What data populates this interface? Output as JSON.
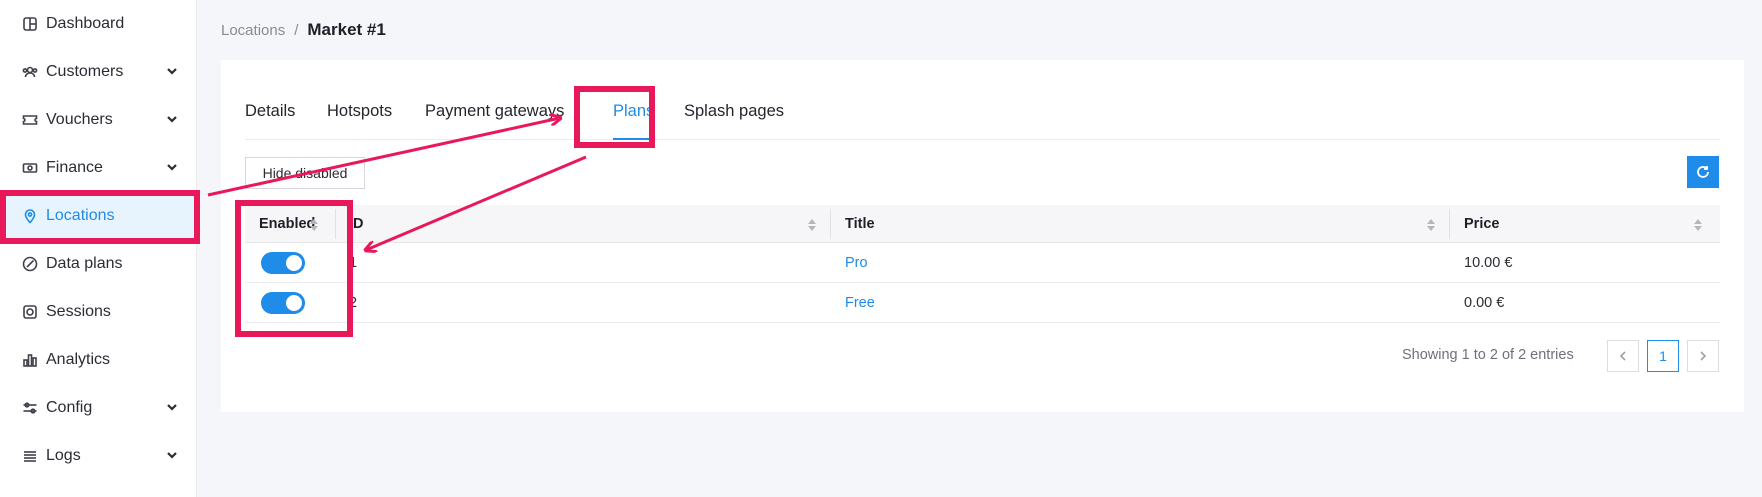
{
  "sidebar": {
    "items": [
      {
        "label": "Dashboard",
        "icon": "dashboard-icon",
        "has_chevron": false
      },
      {
        "label": "Customers",
        "icon": "customers-icon",
        "has_chevron": true
      },
      {
        "label": "Vouchers",
        "icon": "voucher-icon",
        "has_chevron": true
      },
      {
        "label": "Finance",
        "icon": "finance-icon",
        "has_chevron": true
      },
      {
        "label": "Locations",
        "icon": "location-pin-icon",
        "has_chevron": false,
        "active": true
      },
      {
        "label": "Data plans",
        "icon": "data-plans-icon",
        "has_chevron": false
      },
      {
        "label": "Sessions",
        "icon": "sessions-icon",
        "has_chevron": false
      },
      {
        "label": "Analytics",
        "icon": "analytics-icon",
        "has_chevron": false
      },
      {
        "label": "Config",
        "icon": "config-icon",
        "has_chevron": true
      },
      {
        "label": "Logs",
        "icon": "logs-icon",
        "has_chevron": true
      }
    ]
  },
  "breadcrumb": {
    "parent": "Locations",
    "separator": "/",
    "current": "Market #1"
  },
  "tabs": [
    {
      "label": "Details"
    },
    {
      "label": "Hotspots"
    },
    {
      "label": "Payment gateways"
    },
    {
      "label": "Plans",
      "active": true
    },
    {
      "label": "Splash pages"
    }
  ],
  "toolbar": {
    "hide_disabled_label": "Hide disabled",
    "refresh_icon": "refresh-icon"
  },
  "table": {
    "columns": [
      "Enabled",
      "ID",
      "Title",
      "Price"
    ],
    "rows": [
      {
        "enabled": true,
        "id": "1",
        "title": "Pro",
        "price": "10.00 €"
      },
      {
        "enabled": true,
        "id": "2",
        "title": "Free",
        "price": "0.00 €"
      }
    ]
  },
  "pagination": {
    "summary": "Showing 1 to 2 of 2 entries",
    "current_page": "1"
  },
  "colors": {
    "accent": "#1e8ce8",
    "annotation": "#e8195a",
    "active_bg": "#e8f4fd"
  }
}
